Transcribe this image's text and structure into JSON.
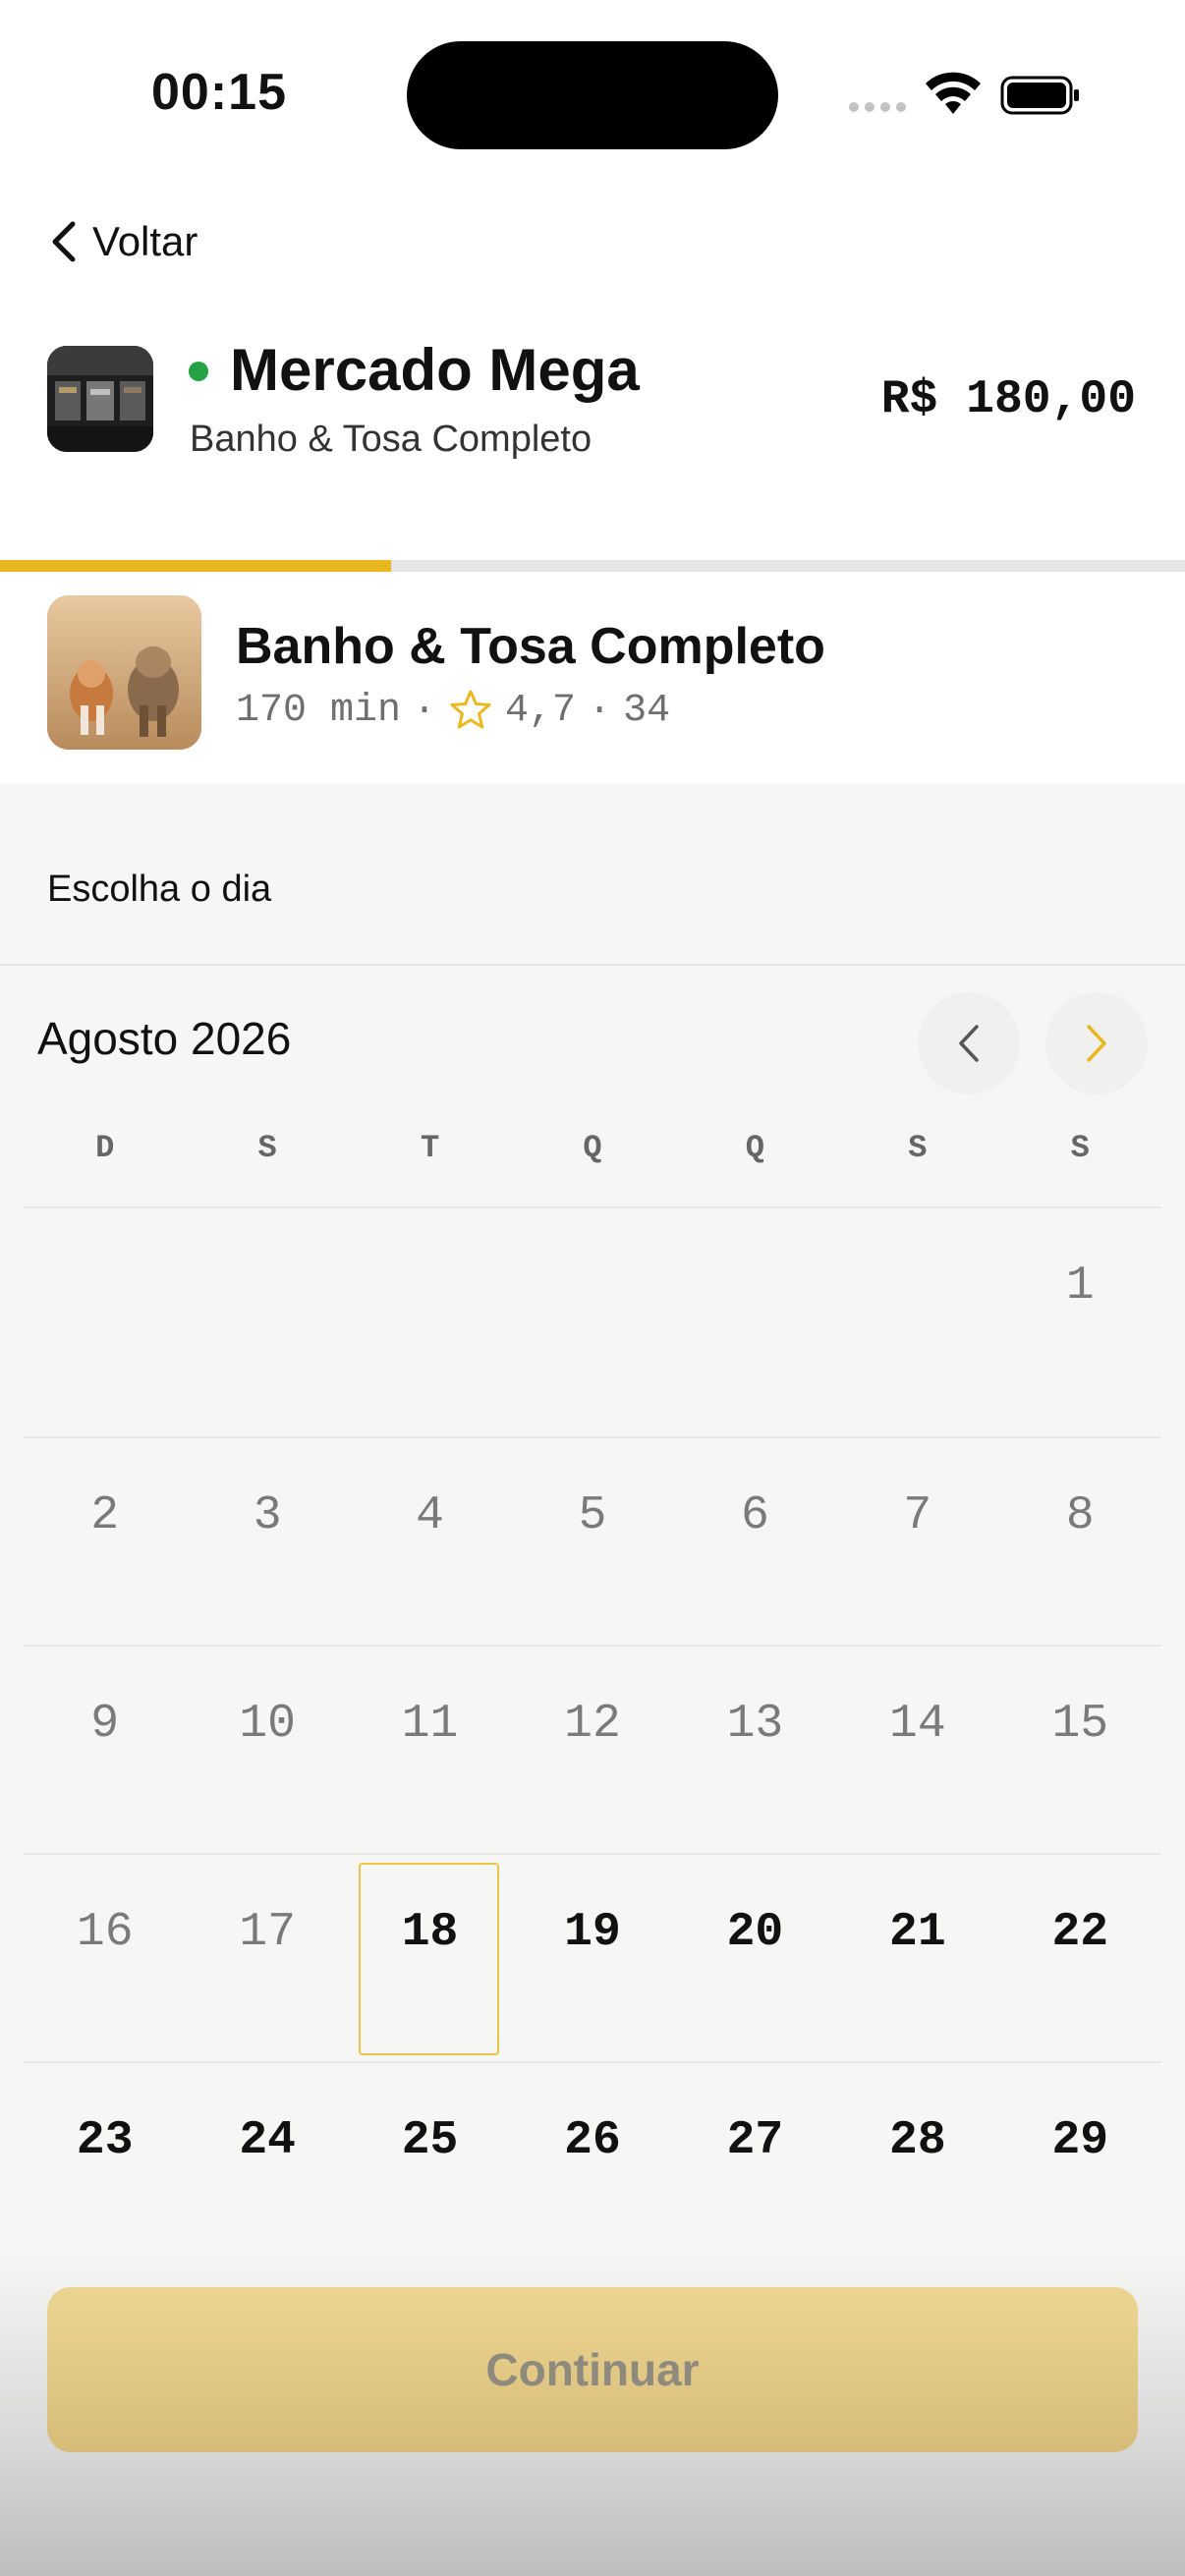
{
  "status_bar": {
    "time": "00:15"
  },
  "header": {
    "back_label": "Voltar",
    "store_name": "Mercado Mega",
    "store_subtitle": "Banho & Tosa Completo",
    "price": "R$ 180,00",
    "online_color": "#25a244"
  },
  "progress": {
    "value": 0.33,
    "color": "#e9b820"
  },
  "service": {
    "name": "Banho & Tosa Completo",
    "duration": "170 min",
    "separator1": "·",
    "rating": "4,7",
    "separator2": "·",
    "reviews": "34"
  },
  "calendar": {
    "section_title": "Escolha o dia",
    "month_label": "Agosto 2026",
    "weekdays": [
      "D",
      "S",
      "T",
      "Q",
      "Q",
      "S",
      "S"
    ],
    "weeks": [
      [
        "",
        "",
        "",
        "",
        "",
        "",
        "1"
      ],
      [
        "2",
        "3",
        "4",
        "5",
        "6",
        "7",
        "8"
      ],
      [
        "9",
        "10",
        "11",
        "12",
        "13",
        "14",
        "15"
      ],
      [
        "16",
        "17",
        "18",
        "19",
        "20",
        "21",
        "22"
      ],
      [
        "23",
        "24",
        "25",
        "26",
        "27",
        "28",
        "29"
      ]
    ],
    "selected": "18",
    "accent_color": "#e9b820"
  },
  "footer": {
    "continue_label": "Continuar"
  }
}
